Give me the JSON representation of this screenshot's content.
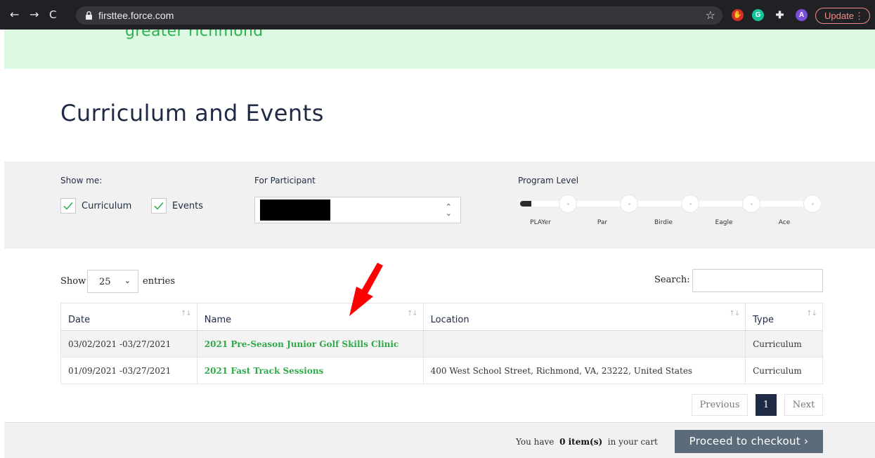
{
  "browser": {
    "url": "firsttee.force.com",
    "update_label": "Update",
    "profile_initial": "A",
    "grammarly_initial": "G"
  },
  "brand": {
    "subtitle": "greater richmond"
  },
  "page": {
    "title": "Curriculum and Events"
  },
  "filters": {
    "show_me_label": "Show me:",
    "curriculum_label": "Curriculum",
    "events_label": "Events",
    "curriculum_checked": true,
    "events_checked": true,
    "participant_label": "For Participant",
    "program_level_label": "Program Level",
    "levels": [
      "PLAYer",
      "Par",
      "Birdie",
      "Eagle",
      "Ace"
    ],
    "level_selected_index": 0
  },
  "table_controls": {
    "show_label": "Show",
    "entries_value": "25",
    "entries_label": "entries",
    "search_label": "Search:"
  },
  "table": {
    "headers": [
      "Date",
      "Name",
      "Location",
      "Type"
    ],
    "rows": [
      {
        "date": "03/02/2021 -03/27/2021",
        "name": "2021 Pre-Season Junior Golf Skills Clinic",
        "location": "",
        "type": "Curriculum"
      },
      {
        "date": "01/09/2021 -03/27/2021",
        "name": "2021 Fast Track Sessions",
        "location": "400 West School Street, Richmond, VA, 23222, United States",
        "type": "Curriculum"
      }
    ]
  },
  "pagination": {
    "previous": "Previous",
    "current": "1",
    "next": "Next"
  },
  "cart": {
    "prefix": "You have",
    "count": "0 item(s)",
    "suffix": "in your cart",
    "checkout_label": "Proceed to checkout ›"
  },
  "colors": {
    "brand_green": "#2fb24f",
    "header_band": "#ddf8e3",
    "link_green": "#2fa84a",
    "navy": "#1f2a44",
    "checkout_bg": "#5c6b79",
    "annotation_arrow": "#ff0000"
  },
  "icons": {
    "back": "back-arrow-icon",
    "forward": "forward-arrow-icon",
    "reload": "reload-icon",
    "lock": "lock-icon",
    "bookmark": "star-icon",
    "extensions": "puzzle-icon",
    "annotation": "red-arrow-icon"
  }
}
